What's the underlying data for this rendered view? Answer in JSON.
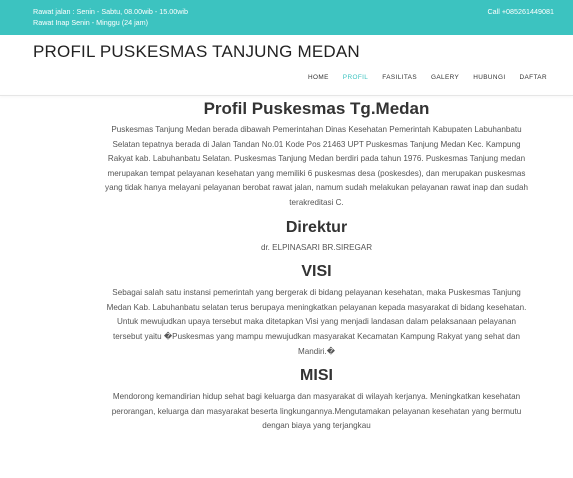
{
  "topbar": {
    "hours_line1": "Rawat jalan : Senin - Sabtu, 08.00wib - 15.00wib",
    "hours_line2": "Rawat Inap Senin - Minggu (24 jam)",
    "call": "Call +085261449081"
  },
  "site_title": "PROFIL PUSKESMAS TANJUNG MEDAN",
  "nav": {
    "home": "HOME",
    "profil": "PROFIL",
    "fasilitas": "FASILITAS",
    "galery": "GALERY",
    "hubungi": "HUBUNGI",
    "daftar": "DAFTAR",
    "active": "PROFIL",
    "active_color": "#3cc3c0"
  },
  "colors": {
    "topbar": "#3cc3c0",
    "heading": "#333333",
    "body_text": "#555555"
  },
  "profil": {
    "heading": "Profil Puskesmas Tg.Medan",
    "text": "Puskesmas Tanjung Medan berada dibawah Pemerintahan Dinas Kesehatan Pemerintah Kabupaten Labuhanbatu Selatan tepatnya berada di Jalan Tandan No.01 Kode Pos 21463 UPT Puskesmas Tanjung Medan Kec. Kampung Rakyat kab. Labuhanbatu Selatan. Puskesmas Tanjung Medan berdiri pada tahun 1976. Puskesmas Tanjung medan merupakan tempat pelayanan kesehatan yang memiliki 6 puskesmas desa (poskesdes), dan merupakan puskesmas yang tidak hanya melayani pelayanan berobat rawat jalan, namum sudah melakukan pelayanan rawat inap dan sudah terakreditasi C."
  },
  "direktur": {
    "heading": "Direktur",
    "name": "dr. ELPINASARI BR.SIREGAR"
  },
  "visi": {
    "heading": "VISI",
    "text": "Sebagai salah satu instansi pemerintah yang bergerak di bidang pelayanan kesehatan, maka Puskesmas Tanjung Medan Kab. Labuhanbatu selatan terus berupaya meningkatkan pelayanan kepada masyarakat di bidang kesehatan. Untuk mewujudkan upaya tersebut maka ditetapkan Visi yang menjadi landasan dalam pelaksanaan pelayanan tersebut yaitu �Puskesmas yang mampu mewujudkan masyarakat Kecamatan Kampung Rakyat yang sehat dan Mandiri.�"
  },
  "misi": {
    "heading": "MISI",
    "text": "Mendorong kemandirian hidup sehat bagi keluarga dan masyarakat di wilayah kerjanya. Meningkatkan kesehatan perorangan, keluarga dan masyarakat beserta lingkungannya.Mengutamakan pelayanan kesehatan yang bermutu dengan biaya yang terjangkau"
  }
}
